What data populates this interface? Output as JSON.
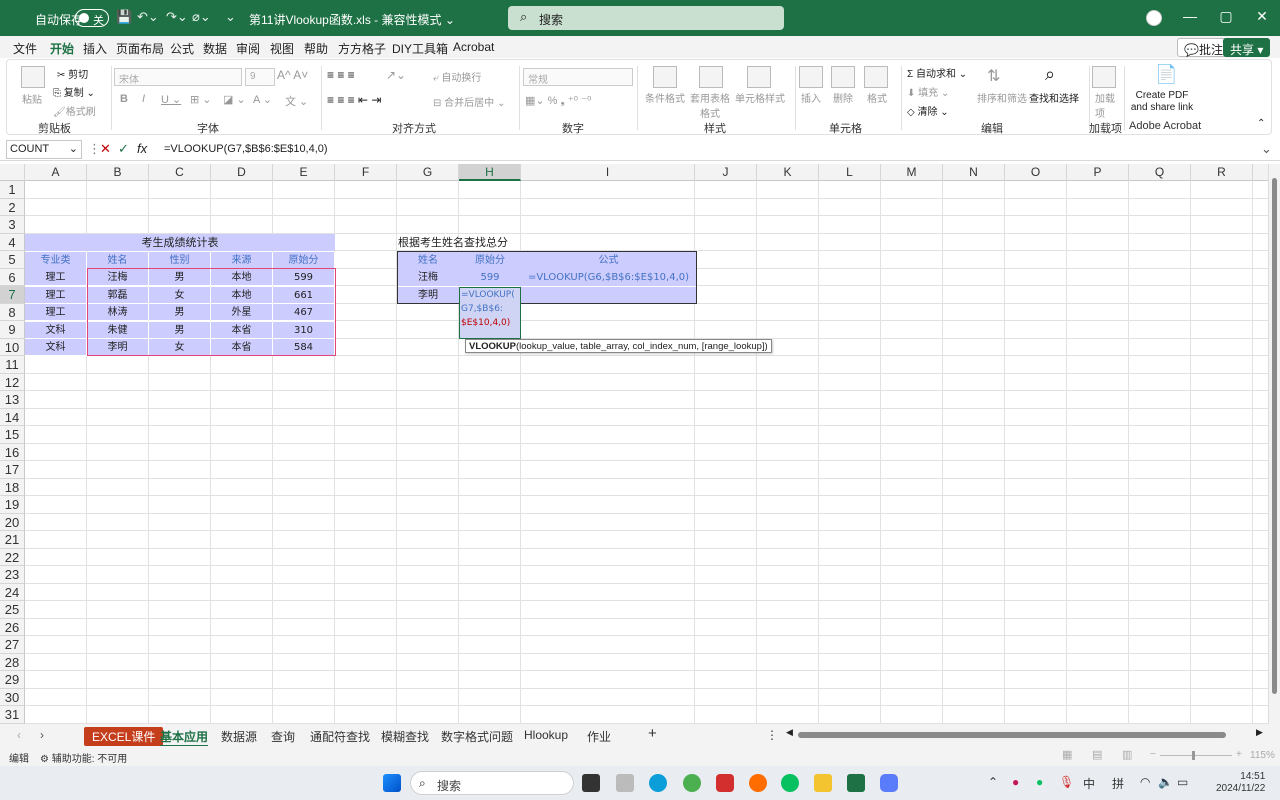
{
  "titlebar": {
    "autosave_label": "自动保存",
    "autosave_state": "关",
    "doc_title": "第11讲Vlookup函数.xls - 兼容性模式 ⌄",
    "search_placeholder": "搜索"
  },
  "tabs": [
    "文件",
    "开始",
    "插入",
    "页面布局",
    "公式",
    "数据",
    "审阅",
    "视图",
    "帮助",
    "方方格子",
    "DIY工具箱",
    "Acrobat"
  ],
  "active_tab": "开始",
  "tab_actions": {
    "comment": "💬批注",
    "share": "共享 ▾"
  },
  "ribbon": {
    "clipboard": {
      "paste": "粘贴",
      "cut": "剪切",
      "copy": "复制",
      "format_painter": "格式刷",
      "label": "剪贴板"
    },
    "font": {
      "font_name": "宋体",
      "font_size": "9",
      "label": "字体"
    },
    "align": {
      "wrap": "自动换行",
      "merge": "合并后居中",
      "label": "对齐方式"
    },
    "number": {
      "format": "常规",
      "label": "数字"
    },
    "styles": {
      "cond": "条件格式",
      "table": "套用表格格式",
      "cell": "单元格样式",
      "label": "样式"
    },
    "cells": {
      "insert": "插入",
      "delete": "删除",
      "format": "格式",
      "label": "单元格"
    },
    "editing": {
      "autosum": "自动求和",
      "fill": "填充",
      "clear": "清除",
      "sort": "排序和筛选",
      "find": "查找和选择",
      "label": "编辑"
    },
    "addins": {
      "btn": "加载项",
      "label": "加载项"
    },
    "acrobat": {
      "btn": "Create PDF and share link",
      "label": "Adobe Acrobat"
    }
  },
  "formula_bar": {
    "name_box": "COUNT",
    "formula": "=VLOOKUP(G7,$B$6:$E$10,4,0)"
  },
  "columns": [
    "A",
    "B",
    "C",
    "D",
    "E",
    "F",
    "G",
    "H",
    "I",
    "J",
    "K",
    "L",
    "M",
    "N",
    "O",
    "P",
    "Q",
    "R"
  ],
  "rows": [
    "1",
    "2",
    "3",
    "4",
    "5",
    "6",
    "7",
    "8",
    "9",
    "10",
    "11",
    "12",
    "13",
    "14",
    "15",
    "16",
    "17",
    "18",
    "19",
    "20",
    "21",
    "22",
    "23",
    "24",
    "25",
    "26",
    "27",
    "28",
    "29",
    "30",
    "31"
  ],
  "table1": {
    "title": "考生成绩统计表",
    "headers": [
      "专业类",
      "姓名",
      "性别",
      "来源",
      "原始分"
    ],
    "rows": [
      [
        "理工",
        "汪梅",
        "男",
        "本地",
        "599"
      ],
      [
        "理工",
        "郭磊",
        "女",
        "本地",
        "661"
      ],
      [
        "理工",
        "林涛",
        "男",
        "外星",
        "467"
      ],
      [
        "文科",
        "朱健",
        "男",
        "本省",
        "310"
      ],
      [
        "文科",
        "李明",
        "女",
        "本省",
        "584"
      ]
    ]
  },
  "table2": {
    "title": "根据考生姓名查找总分",
    "headers": [
      "姓名",
      "原始分",
      "公式"
    ],
    "row1": [
      "汪梅",
      "599",
      "=VLOOKUP(G6,$B$6:$E$10,4,0)"
    ],
    "row2_name": "李明",
    "editing_line1": "=VLOOKUP(",
    "editing_line2": "G7,$B$6:",
    "editing_line3": "$E$10,4,0)"
  },
  "tooltip": {
    "func": "VLOOKUP",
    "args": "(lookup_value, table_array, col_index_num, [range_lookup])"
  },
  "sheets": [
    "EXCEL课件",
    "基本应用",
    "数据源",
    "查询",
    "通配符查找",
    "模糊查找",
    "数字格式问题",
    "Hlookup",
    "作业"
  ],
  "active_sheet": "基本应用",
  "status": {
    "mode": "编辑",
    "accessibility": "辅助功能: 不可用",
    "zoom": "115%"
  },
  "taskbar": {
    "search": "搜索",
    "ime1": "中",
    "ime2": "拼",
    "time": "14:51",
    "date": "2024/11/22"
  }
}
